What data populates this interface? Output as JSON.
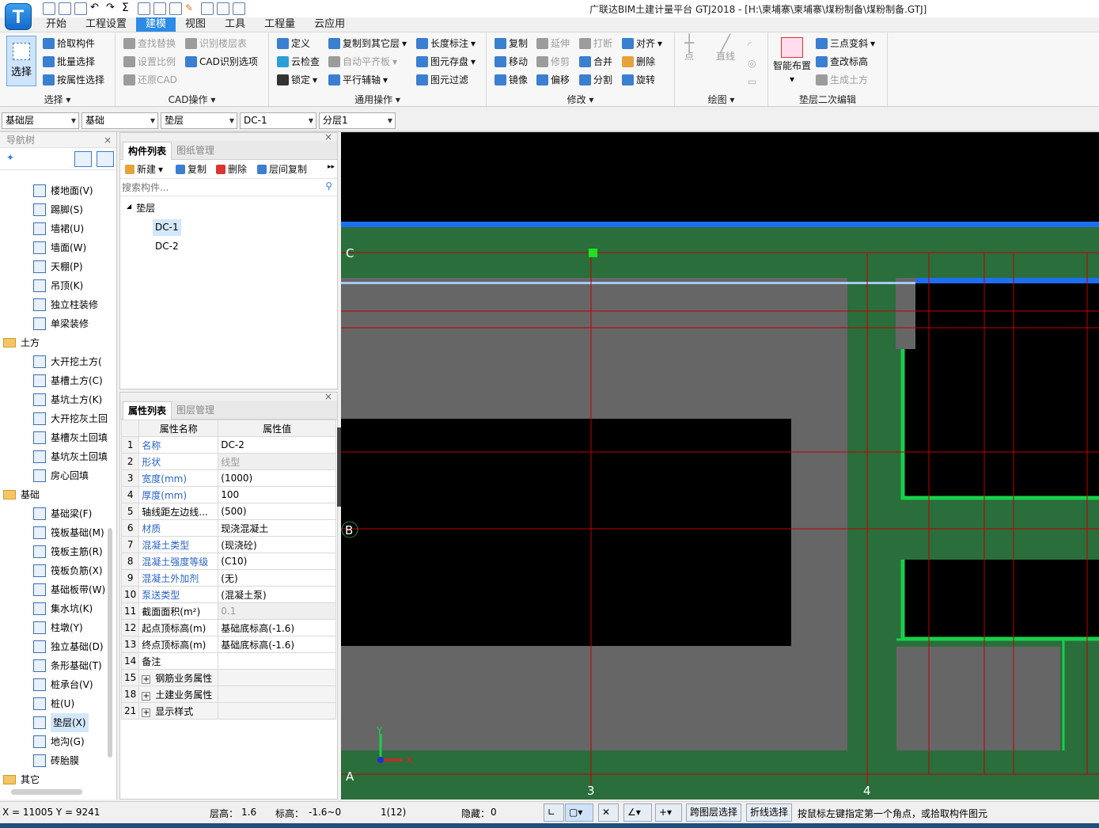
{
  "window": {
    "title": "广联达BIM土建计量平台 GTJ2018 - [H:\\柬埔寨\\柬埔寨\\煤粉制备\\煤粉制备.GTJ]",
    "logo_letter": "T"
  },
  "menu": {
    "tabs": [
      "开始",
      "工程设置",
      "建模",
      "视图",
      "工具",
      "工程量",
      "云应用"
    ],
    "active": "建模"
  },
  "ribbon": {
    "select": {
      "big_button": "选择",
      "items": [
        "拾取构件",
        "批量选择",
        "按属性选择"
      ],
      "group_label": "选择"
    },
    "cad": {
      "items": [
        "查找替换",
        "识别楼层表",
        "设置比例",
        "CAD识别选项",
        "还原CAD"
      ],
      "group_label": "CAD操作"
    },
    "common": {
      "items": [
        "定义",
        "复制到其它层",
        "长度标注",
        "云检查",
        "自动平齐板",
        "图元存盘",
        "锁定",
        "平行辅轴",
        "图元过滤"
      ],
      "group_label": "通用操作"
    },
    "modify": {
      "items": [
        "复制",
        "延伸",
        "打断",
        "对齐",
        "移动",
        "修剪",
        "合并",
        "删除",
        "镜像",
        "偏移",
        "分割",
        "旋转"
      ],
      "group_label": "修改"
    },
    "draw": {
      "items": [
        "点",
        "直线"
      ],
      "group_label": "绘图"
    },
    "cushion_edit": {
      "big_button": "智能布置",
      "items": [
        "三点变斜",
        "查改标高",
        "生成土方"
      ],
      "group_label": "垫层二次编辑"
    }
  },
  "combos": [
    "基础层",
    "基础",
    "垫层",
    "DC-1",
    "分层1"
  ],
  "nav": {
    "title": "导航树",
    "items": [
      {
        "label": "楼地面(V)",
        "type": "item"
      },
      {
        "label": "踢脚(S)",
        "type": "item"
      },
      {
        "label": "墙裙(U)",
        "type": "item"
      },
      {
        "label": "墙面(W)",
        "type": "item"
      },
      {
        "label": "天棚(P)",
        "type": "item"
      },
      {
        "label": "吊顶(K)",
        "type": "item"
      },
      {
        "label": "独立柱装修",
        "type": "item"
      },
      {
        "label": "单梁装修",
        "type": "item"
      },
      {
        "label": "土方",
        "type": "folder"
      },
      {
        "label": "大开挖土方(",
        "type": "item"
      },
      {
        "label": "基槽土方(C)",
        "type": "item"
      },
      {
        "label": "基坑土方(K)",
        "type": "item"
      },
      {
        "label": "大开挖灰土回",
        "type": "item"
      },
      {
        "label": "基槽灰土回填",
        "type": "item"
      },
      {
        "label": "基坑灰土回填",
        "type": "item"
      },
      {
        "label": "房心回填",
        "type": "item"
      },
      {
        "label": "基础",
        "type": "folder"
      },
      {
        "label": "基础梁(F)",
        "type": "item"
      },
      {
        "label": "筏板基础(M)",
        "type": "item"
      },
      {
        "label": "筏板主筋(R)",
        "type": "item"
      },
      {
        "label": "筏板负筋(X)",
        "type": "item"
      },
      {
        "label": "基础板带(W)",
        "type": "item"
      },
      {
        "label": "集水坑(K)",
        "type": "item"
      },
      {
        "label": "柱墩(Y)",
        "type": "item"
      },
      {
        "label": "独立基础(D)",
        "type": "item"
      },
      {
        "label": "条形基础(T)",
        "type": "item"
      },
      {
        "label": "桩承台(V)",
        "type": "item"
      },
      {
        "label": "桩(U)",
        "type": "item"
      },
      {
        "label": "垫层(X)",
        "type": "item",
        "selected": true
      },
      {
        "label": "地沟(G)",
        "type": "item"
      },
      {
        "label": "砖胎膜",
        "type": "item"
      },
      {
        "label": "其它",
        "type": "folder"
      }
    ]
  },
  "component_panel": {
    "tabs": [
      "构件列表",
      "图纸管理"
    ],
    "toolbar": [
      "新建",
      "复制",
      "删除",
      "层间复制"
    ],
    "search_placeholder": "搜索构件...",
    "tree_root": "垫层",
    "components": [
      "DC-1",
      "DC-2"
    ],
    "selected": "DC-1"
  },
  "property_panel": {
    "tabs": [
      "属性列表",
      "图层管理"
    ],
    "headers": [
      "属性名称",
      "属性值"
    ],
    "rows": [
      {
        "num": "1",
        "name": "名称",
        "value": "DC-2",
        "blue": true
      },
      {
        "num": "2",
        "name": "形状",
        "value": "线型",
        "blue": true,
        "grey": true
      },
      {
        "num": "3",
        "name": "宽度(mm)",
        "value": "(1000)",
        "blue": true
      },
      {
        "num": "4",
        "name": "厚度(mm)",
        "value": "100",
        "blue": true
      },
      {
        "num": "5",
        "name": "轴线距左边线...",
        "value": "(500)",
        "blue": false
      },
      {
        "num": "6",
        "name": "材质",
        "value": "现浇混凝土",
        "blue": true
      },
      {
        "num": "7",
        "name": "混凝土类型",
        "value": "(现浇砼)",
        "blue": true
      },
      {
        "num": "8",
        "name": "混凝土强度等级",
        "value": "(C10)",
        "blue": true
      },
      {
        "num": "9",
        "name": "混凝土外加剂",
        "value": "(无)",
        "blue": true
      },
      {
        "num": "10",
        "name": "泵送类型",
        "value": "(混凝土泵)",
        "blue": true
      },
      {
        "num": "11",
        "name": "截面面积(m²)",
        "value": "0.1",
        "blue": false,
        "grey": true
      },
      {
        "num": "12",
        "name": "起点顶标高(m)",
        "value": "基础底标高(-1.6)",
        "blue": false
      },
      {
        "num": "13",
        "name": "终点顶标高(m)",
        "value": "基础底标高(-1.6)",
        "blue": false
      },
      {
        "num": "14",
        "name": "备注",
        "value": "",
        "blue": false
      },
      {
        "num": "15",
        "name": "钢筋业务属性",
        "value": "",
        "group": true
      },
      {
        "num": "18",
        "name": "土建业务属性",
        "value": "",
        "group": true
      },
      {
        "num": "21",
        "name": "显示样式",
        "value": "",
        "group": true
      }
    ]
  },
  "canvas": {
    "axis_labels": {
      "c": "C",
      "b": "B",
      "a": "A",
      "x3": "3",
      "x4": "4"
    },
    "ucs": {
      "x": "X",
      "y": "Y"
    },
    "colors": {
      "background": "#000000",
      "green": "#2a6e3c",
      "grey": "#666666",
      "blue": "#1e6ef0",
      "axis": "#c00000"
    }
  },
  "status": {
    "coords": "X = 11005 Y = 9241",
    "floor_height_label": "层高：",
    "floor_height": "1.6",
    "elevation_label": "标高：",
    "elevation": "-1.6~0",
    "count": "1(12)",
    "hidden_label": "隐藏：",
    "hidden": "0",
    "btn_cross_layer": "跨图层选择",
    "btn_polyline": "折线选择",
    "hint": "按鼠标左键指定第一个角点，或拾取构件图元"
  }
}
